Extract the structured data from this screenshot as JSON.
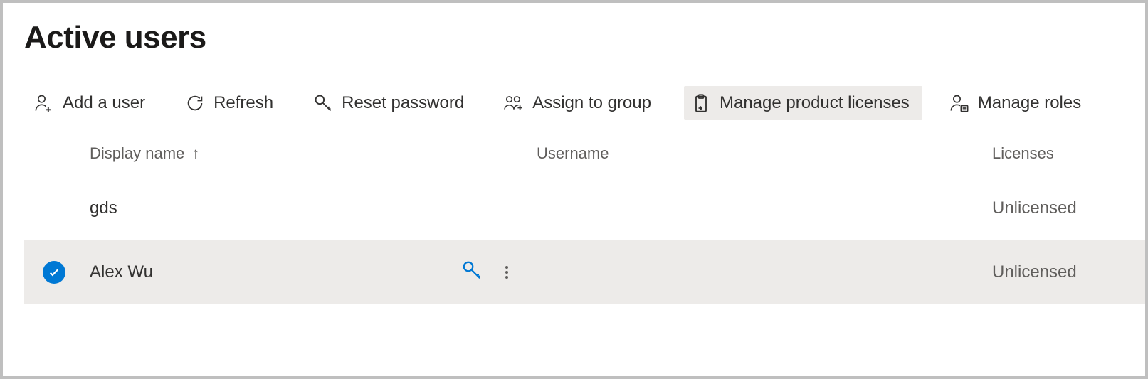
{
  "page": {
    "title": "Active users"
  },
  "toolbar": {
    "add_user": "Add a user",
    "refresh": "Refresh",
    "reset_password": "Reset password",
    "assign_to_group": "Assign to group",
    "manage_product_licenses": "Manage product licenses",
    "manage_roles": "Manage roles"
  },
  "columns": {
    "display_name": "Display name",
    "username": "Username",
    "licenses": "Licenses",
    "sort_arrow": "↑"
  },
  "rows": [
    {
      "display_name": "gds",
      "username": "",
      "licenses": "Unlicensed",
      "selected": false
    },
    {
      "display_name": "Alex Wu",
      "username": "",
      "licenses": "Unlicensed",
      "selected": true
    }
  ]
}
